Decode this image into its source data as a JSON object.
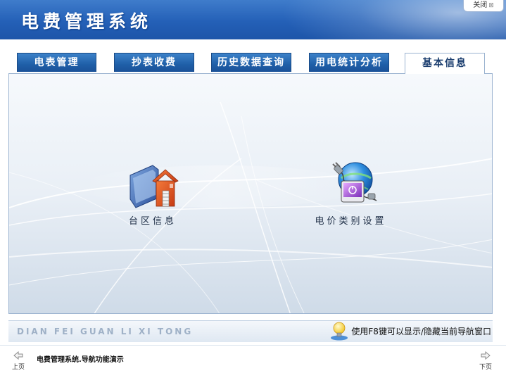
{
  "header": {
    "title": "电费管理系统",
    "close_label": "关闭",
    "close_glyph": "⊠"
  },
  "tabs": [
    {
      "label": "电表管理",
      "active": false
    },
    {
      "label": "抄表收费",
      "active": false
    },
    {
      "label": "历史数据查询",
      "active": false
    },
    {
      "label": "用电统计分析",
      "active": false
    },
    {
      "label": "基本信息",
      "active": true
    }
  ],
  "shortcuts": [
    {
      "label": "台区信息",
      "icon": "folder-house-icon"
    },
    {
      "label": "电价类别设置",
      "icon": "power-plug-globe-icon"
    }
  ],
  "tipbar": {
    "pinyin": "DIAN FEI GUAN LI XI TONG",
    "tip": "使用F8键可以显示/隐藏当前导航窗口"
  },
  "footer": {
    "prev_label": "上页",
    "next_label": "下页",
    "message": "电费管理系统.导航功能演示"
  },
  "colors": {
    "header_blue": "#2460b7",
    "tab_blue": "#1f5fa8",
    "panel_bg": "#e9eff6"
  }
}
